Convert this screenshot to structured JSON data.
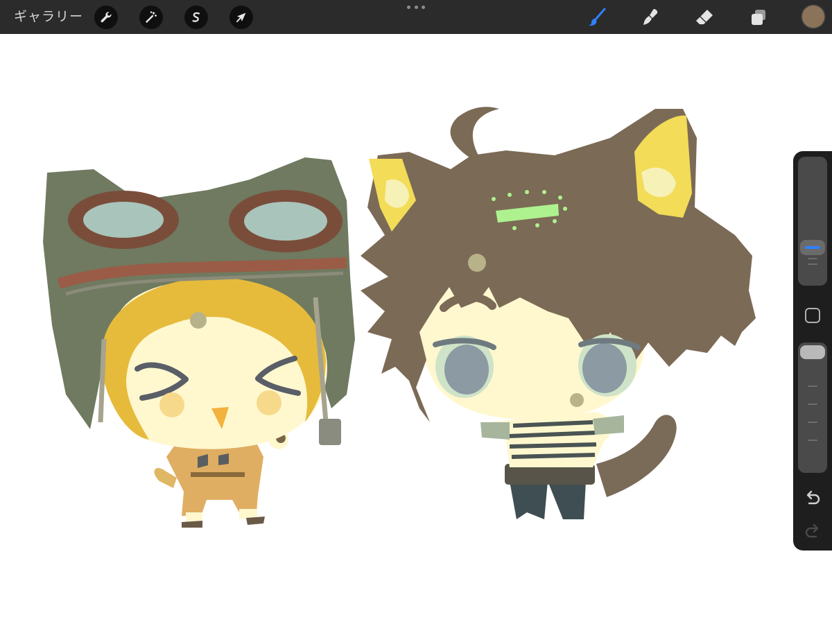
{
  "toolbar": {
    "gallery_label": "ギャラリー",
    "left_tools": [
      {
        "icon": "wrench-icon",
        "name": "actions"
      },
      {
        "icon": "magic-wand-icon",
        "name": "adjustments"
      },
      {
        "icon": "selection-s-icon",
        "name": "selection"
      },
      {
        "icon": "arrow-cursor-icon",
        "name": "transform"
      }
    ],
    "right_tools": [
      {
        "icon": "brush-icon",
        "name": "paint",
        "active": true
      },
      {
        "icon": "smudge-icon",
        "name": "smudge",
        "active": false
      },
      {
        "icon": "eraser-icon",
        "name": "erase",
        "active": false
      },
      {
        "icon": "layers-icon",
        "name": "layers",
        "active": false
      }
    ],
    "current_color": "#8b7359",
    "accent_color": "#2f80ff"
  },
  "sidebar": {
    "brush_size_level": 0.66,
    "opacity_level": 1.0,
    "buttons": [
      "modify-button",
      "undo-button",
      "redo-button"
    ],
    "redo_enabled": false
  },
  "canvas": {
    "background": "#ffffff"
  }
}
